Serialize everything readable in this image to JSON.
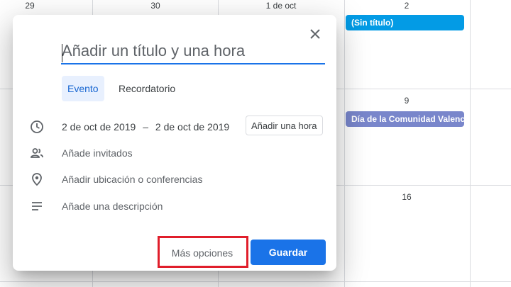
{
  "calendar": {
    "days": [
      "29",
      "30",
      "1 de oct",
      "2",
      "9",
      "16"
    ],
    "events": [
      {
        "label": "(Sin título)",
        "color": "#039be5"
      },
      {
        "label": "Día de la Comunidad Valenc",
        "color": "#7986cb"
      }
    ]
  },
  "dialog": {
    "title_placeholder": "Añadir un título y una hora",
    "tabs": [
      "Evento",
      "Recordatorio"
    ],
    "date_start": "2 de oct de 2019",
    "date_separator": "–",
    "date_end": "2 de oct de 2019",
    "add_time_label": "Añadir una hora",
    "guests_label": "Añade invitados",
    "location_label": "Añadir ubicación o conferencias",
    "description_label": "Añade una descripción",
    "more_options_label": "Más opciones",
    "save_label": "Guardar",
    "icons": [
      "close-icon",
      "clock-icon",
      "people-icon",
      "location-pin-icon",
      "notes-icon"
    ]
  },
  "colors": {
    "accent": "#1a73e8",
    "highlight_box": "#e01e2b"
  }
}
